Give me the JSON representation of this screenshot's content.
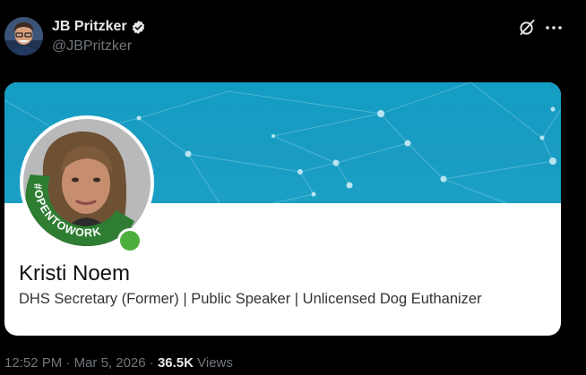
{
  "post": {
    "author": {
      "name": "JB Pritzker",
      "handle": "@JBPritzker",
      "verified": true
    },
    "actions": {
      "grok_icon": "grok-icon",
      "more_icon": "more-icon"
    },
    "card": {
      "open_to_work_badge": "#OPENTOWORK",
      "name": "Kristi Noem",
      "headline": "DHS Secretary (Former) | Public Speaker | Unlicensed Dog Euthanizer"
    },
    "meta": {
      "time": "12:52 PM",
      "separator": " · ",
      "date": "Mar 5, 2026",
      "views_count": "36.5K",
      "views_label": " Views"
    }
  },
  "colors": {
    "background": "#000000",
    "banner": "#1a9cc2",
    "open_to_work_green": "#2e7d32",
    "verified_blue": "#1d9bf0",
    "muted_text": "#71767b"
  }
}
